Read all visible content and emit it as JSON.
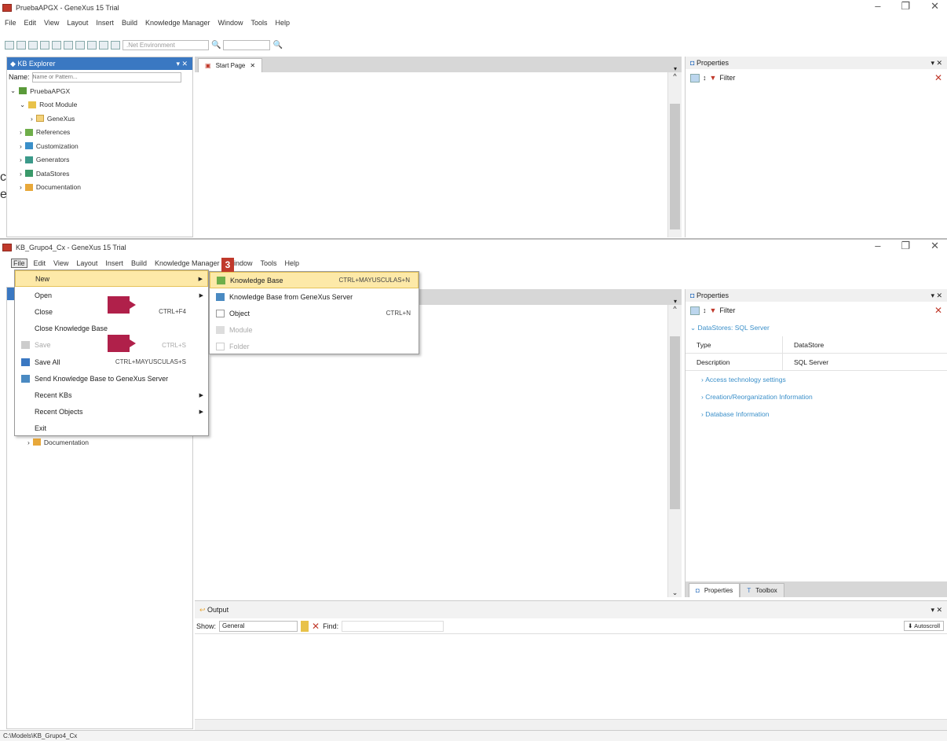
{
  "win1": {
    "title": "PruebaAPGX - GeneXus 15 Trial",
    "menu": [
      "File",
      "Edit",
      "View",
      "Layout",
      "Insert",
      "Build",
      "Knowledge Manager",
      "Window",
      "Tools",
      "Help"
    ],
    "env_select": ".Net Environment",
    "kb_explorer": {
      "title": "KB Explorer",
      "name_label": "Name:",
      "name_placeholder": "Name or Pattern...",
      "tree": [
        {
          "label": "PruebaAPGX",
          "indent": 0
        },
        {
          "label": "Root Module",
          "indent": 1
        },
        {
          "label": "GeneXus",
          "indent": 2
        },
        {
          "label": "References",
          "indent": 1
        },
        {
          "label": "Customization",
          "indent": 1
        },
        {
          "label": "Generators",
          "indent": 1
        },
        {
          "label": "DataStores",
          "indent": 1
        },
        {
          "label": "Documentation",
          "indent": 1
        }
      ]
    },
    "start_tab": "Start Page",
    "properties": {
      "title": "Properties",
      "filter": "Filter"
    }
  },
  "win2": {
    "title": "KB_Grupo4_Cx - GeneXus 15 Trial",
    "menu": [
      "File",
      "Edit",
      "View",
      "Layout",
      "Insert",
      "Build",
      "Knowledge Manager",
      "Window",
      "Tools",
      "Help"
    ],
    "file_menu": [
      {
        "label": "New",
        "shortcut": "",
        "arrow": true,
        "disabled": false,
        "highlight": true
      },
      {
        "label": "Open",
        "shortcut": "",
        "arrow": true,
        "disabled": false
      },
      {
        "label": "Close",
        "shortcut": "CTRL+F4",
        "arrow": false,
        "disabled": false
      },
      {
        "label": "Close Knowledge Base",
        "shortcut": "",
        "arrow": false,
        "disabled": false
      },
      {
        "label": "Save",
        "shortcut": "CTRL+S",
        "arrow": false,
        "disabled": true
      },
      {
        "label": "Save All",
        "shortcut": "CTRL+MAYUSCULAS+S",
        "arrow": false,
        "disabled": false
      },
      {
        "label": "Send Knowledge Base to GeneXus Server",
        "shortcut": "",
        "arrow": false,
        "disabled": false
      },
      {
        "label": "Recent KBs",
        "shortcut": "",
        "arrow": true,
        "disabled": false
      },
      {
        "label": "Recent Objects",
        "shortcut": "",
        "arrow": true,
        "disabled": false
      },
      {
        "label": "Exit",
        "shortcut": "",
        "arrow": false,
        "disabled": false
      }
    ],
    "new_submenu": [
      {
        "label": "Knowledge Base",
        "shortcut": "CTRL+MAYUSCULAS+N",
        "disabled": false,
        "highlight": true
      },
      {
        "label": "Knowledge Base from GeneXus Server",
        "shortcut": "",
        "disabled": false
      },
      {
        "label": "Object",
        "shortcut": "CTRL+N",
        "disabled": false
      },
      {
        "label": "Module",
        "shortcut": "",
        "disabled": true
      },
      {
        "label": "Folder",
        "shortcut": "",
        "disabled": true
      }
    ],
    "step_badge": "3",
    "tree_visible": "Documentation",
    "properties": {
      "title": "Properties",
      "filter": "Filter",
      "section": "DataStores: SQL Server",
      "rows": [
        {
          "name": "Type",
          "value": "DataStore"
        },
        {
          "name": "Description",
          "value": "SQL Server"
        }
      ],
      "groups": [
        "Access technology settings",
        "Creation/Reorganization Information",
        "Database Information"
      ],
      "bottom_tabs": [
        "Properties",
        "Toolbox"
      ]
    },
    "output": {
      "title": "Output",
      "show_label": "Show:",
      "show_value": "General",
      "find_label": "Find:",
      "autoscroll": "Autoscroll"
    },
    "status": "C:\\Models\\KB_Grupo4_Cx"
  },
  "colors": {
    "accent": "#3a78c2",
    "highlight": "#fde9a8",
    "marker": "#b0204a",
    "badge": "#c0392b"
  },
  "cropped_text": "c e"
}
